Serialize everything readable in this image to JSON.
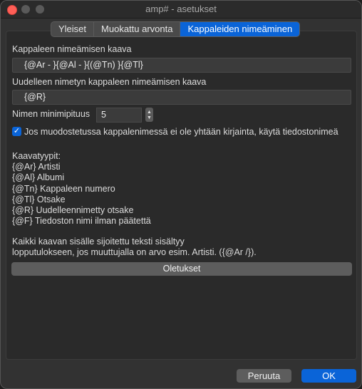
{
  "window": {
    "title": "amp# - asetukset"
  },
  "tabs": [
    {
      "label": "Yleiset"
    },
    {
      "label": "Muokattu arvonta"
    },
    {
      "label": "Kappaleiden nimeäminen"
    }
  ],
  "naming": {
    "formula_label": "Kappaleen nimeämisen kaava",
    "formula_value": "{@Ar - }{@Al - }{(@Tn) }{@Tl}",
    "renamed_label": "Uudelleen nimetyn kappaleen nimeämisen kaava",
    "renamed_value": "{@R}",
    "minlen_label": "Nimen minimipituus",
    "minlen_value": "5",
    "checkbox_label": "Jos muodostetussa kappalenimessä ei ole yhtään kirjainta, käytä tiedostonimeä",
    "checkbox_checked": true
  },
  "help": {
    "types_title": "Kaavatyypit:",
    "types": [
      "{@Ar} Artisti",
      "{@Al} Albumi",
      "{@Tn} Kappaleen numero",
      "{@Tl} Otsake",
      "{@R} Uudelleennimetty otsake",
      "{@F} Tiedoston nimi ilman päätettä"
    ],
    "note_line1": "Kaikki kaavan sisälle sijoitettu teksti sisältyy",
    "note_line2": "lopputulokseen, jos muuttujalla on arvo esim. Artisti. ({@Ar /})."
  },
  "buttons": {
    "defaults": "Oletukset",
    "cancel": "Peruuta",
    "ok": "OK"
  },
  "colors": {
    "accent": "#0a64d8",
    "close": "#fe5f57"
  }
}
